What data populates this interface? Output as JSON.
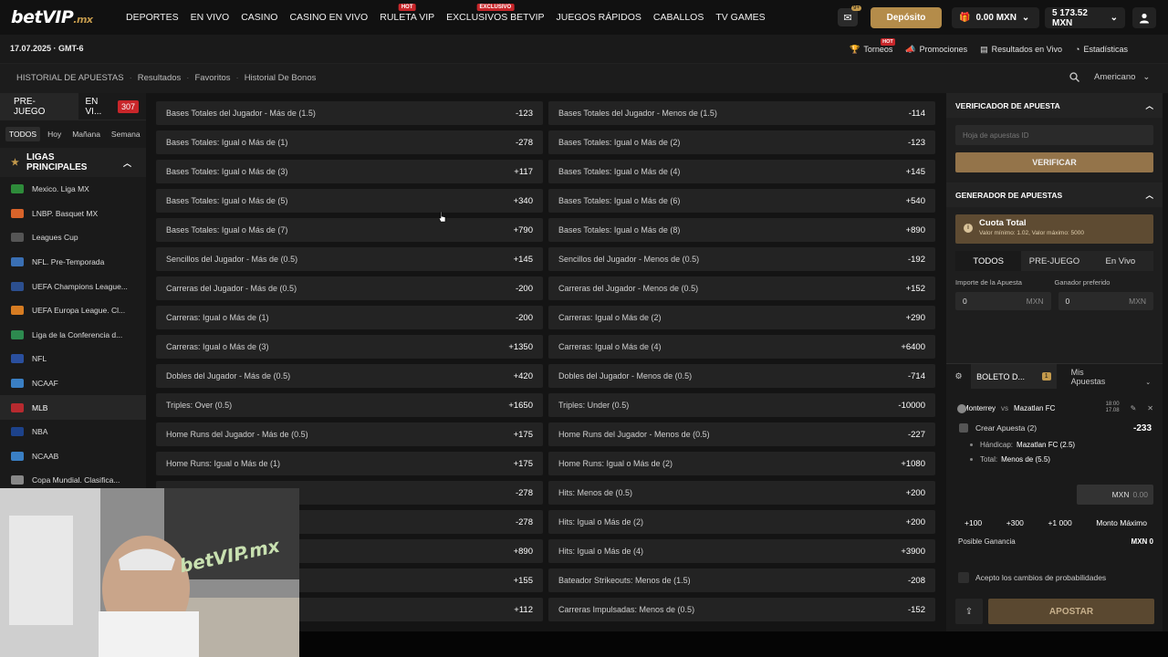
{
  "brand": {
    "logo_main": "betVIP",
    "logo_suffix": ".mx"
  },
  "nav": {
    "links": [
      {
        "label": "DEPORTES",
        "tag": ""
      },
      {
        "label": "EN VIVO",
        "tag": ""
      },
      {
        "label": "CASINO",
        "tag": ""
      },
      {
        "label": "CASINO EN VIVO",
        "tag": ""
      },
      {
        "label": "RULETA VIP",
        "tag": "HOT"
      },
      {
        "label": "EXCLUSIVOS BETVIP",
        "tag": "EXCLUSIVO"
      },
      {
        "label": "JUEGOS RÁPIDOS",
        "tag": ""
      },
      {
        "label": "CABALLOS",
        "tag": ""
      },
      {
        "label": "TV GAMES",
        "tag": ""
      }
    ],
    "mail_badge": "9+",
    "deposit_label": "Depósito",
    "bonus_balance": "0.00 MXN",
    "balance": "5 173.52 MXN"
  },
  "subbar": {
    "datetime": "17.07.2025 · GMT-6",
    "torneos": "Torneos",
    "torneos_tag": "HOT",
    "promociones": "Promociones",
    "resultados": "Resultados en Vivo",
    "estadisticas": "Estadísticas"
  },
  "crumbs": {
    "c1": "HISTORIAL DE APUESTAS",
    "c2": "Resultados",
    "c3": "Favoritos",
    "c4": "Historial De Bonos",
    "odds_format": "Americano"
  },
  "sidebar": {
    "tab_pre": "PRE-JUEGO",
    "tab_live": "EN VI...",
    "live_count": "307",
    "filters": [
      "TODOS",
      "Hoy",
      "Mañana",
      "Semana"
    ],
    "section_title": "LIGAS PRINCIPALES",
    "leagues": [
      {
        "label": "Mexico. Liga MX",
        "color": "#2e8b3a"
      },
      {
        "label": "LNBP. Basquet MX",
        "color": "#d8632a"
      },
      {
        "label": "Leagues Cup",
        "color": "#555555"
      },
      {
        "label": "NFL. Pre-Temporada",
        "color": "#3a6fb3"
      },
      {
        "label": "UEFA Champions League...",
        "color": "#2c4f8f"
      },
      {
        "label": "UEFA Europa League. Cl...",
        "color": "#d67c22"
      },
      {
        "label": "Liga de la Conferencia d...",
        "color": "#2d8a4f"
      },
      {
        "label": "NFL",
        "color": "#2a4f9e"
      },
      {
        "label": "NCAAF",
        "color": "#3a7fc4"
      },
      {
        "label": "MLB",
        "color": "#b72a2f"
      },
      {
        "label": "NBA",
        "color": "#1d428a"
      },
      {
        "label": "NCAAB",
        "color": "#3a7fc4"
      },
      {
        "label": "Copa Mundial. Clasifica...",
        "color": "#888888"
      }
    ]
  },
  "odds": {
    "left": [
      {
        "label": "Bases Totales del Jugador - Más de (1.5)",
        "value": "-123"
      },
      {
        "label": "Bases Totales: Igual o Más de (1)",
        "value": "-278"
      },
      {
        "label": "Bases Totales: Igual o Más de (3)",
        "value": "+117"
      },
      {
        "label": "Bases Totales: Igual o Más de (5)",
        "value": "+340"
      },
      {
        "label": "Bases Totales: Igual o Más de (7)",
        "value": "+790"
      },
      {
        "label": "Sencillos del Jugador - Más de (0.5)",
        "value": "+145"
      },
      {
        "label": "Carreras del Jugador - Más de (0.5)",
        "value": "-200"
      },
      {
        "label": "Carreras: Igual o Más de (1)",
        "value": "-200"
      },
      {
        "label": "Carreras: Igual o Más de (3)",
        "value": "+1350"
      },
      {
        "label": "Dobles del Jugador - Más de (0.5)",
        "value": "+420"
      },
      {
        "label": "Triples: Over (0.5)",
        "value": "+1650"
      },
      {
        "label": "Home Runs del Jugador - Más de (0.5)",
        "value": "+175"
      },
      {
        "label": "Home Runs: Igual o Más de (1)",
        "value": "+175"
      },
      {
        "label": "",
        "value": "-278"
      },
      {
        "label": "",
        "value": "-278"
      },
      {
        "label": "",
        "value": "+890"
      },
      {
        "label": "",
        "value": "+155"
      },
      {
        "label": "",
        "value": "+112"
      }
    ],
    "right": [
      {
        "label": "Bases Totales del Jugador - Menos de (1.5)",
        "value": "-114"
      },
      {
        "label": "Bases Totales: Igual o Más de (2)",
        "value": "-123"
      },
      {
        "label": "Bases Totales: Igual o Más de (4)",
        "value": "+145"
      },
      {
        "label": "Bases Totales: Igual o Más de (6)",
        "value": "+540"
      },
      {
        "label": "Bases Totales: Igual o Más de (8)",
        "value": "+890"
      },
      {
        "label": "Sencillos del Jugador - Menos de (0.5)",
        "value": "-192"
      },
      {
        "label": "Carreras del Jugador - Menos de (0.5)",
        "value": "+152"
      },
      {
        "label": "Carreras: Igual o Más de (2)",
        "value": "+290"
      },
      {
        "label": "Carreras: Igual o Más de (4)",
        "value": "+6400"
      },
      {
        "label": "Dobles del Jugador - Menos de (0.5)",
        "value": "-714"
      },
      {
        "label": "Triples: Under (0.5)",
        "value": "-10000"
      },
      {
        "label": "Home Runs del Jugador - Menos de (0.5)",
        "value": "-227"
      },
      {
        "label": "Home Runs: Igual o Más de (2)",
        "value": "+1080"
      },
      {
        "label": "Hits: Menos de (0.5)",
        "value": "+200"
      },
      {
        "label": "Hits: Igual o Más de (2)",
        "value": "+200"
      },
      {
        "label": "Hits: Igual o Más de (4)",
        "value": "+3900"
      },
      {
        "label": "Bateador Strikeouts: Menos de (1.5)",
        "value": "-208"
      },
      {
        "label": "Carreras Impulsadas: Menos de (0.5)",
        "value": "-152"
      }
    ]
  },
  "verifier": {
    "title": "VERIFICADOR DE APUESTA",
    "placeholder": "Hoja de apuestas ID",
    "button": "VERIFICAR"
  },
  "generator": {
    "title": "GENERADOR DE APUESTAS",
    "cuota_title": "Cuota Total",
    "cuota_sub": "Valor mínimo: 1.02, Valor máximo: 5000",
    "tabs": [
      "TODOS",
      "PRE-JUEGO",
      "En Vivo"
    ],
    "amount_label": "Importe de la Apuesta",
    "winner_label": "Ganador preferido",
    "amount_value": "0",
    "winner_value": "0",
    "currency": "MXN"
  },
  "slip": {
    "tab1": "BOLETO D...",
    "tab1_count": "1",
    "tab2": "Mis Apuestas",
    "home": "Monterrey",
    "vs": "vs",
    "away": "Mazatlan FC",
    "time": "18:00",
    "date": "17.08",
    "crear": "Crear Apuesta (2)",
    "crear_odds": "-233",
    "leg1_label": "Hándicap:",
    "leg1_value": "Mazatlan FC (2.5)",
    "leg2_label": "Total:",
    "leg2_value": "Menos de (5.5)",
    "stake_cur": "MXN",
    "stake_val": "0.00",
    "quick": [
      "+100",
      "+300",
      "+1 000",
      "Monto Máximo"
    ],
    "posible_label": "Posible Ganancia",
    "posible_value": "MXN 0",
    "accept": "Acepto los cambios de probabilidades",
    "bet_button": "APOSTAR"
  },
  "webcam": {
    "overlay_text": "betVIP.mx"
  }
}
